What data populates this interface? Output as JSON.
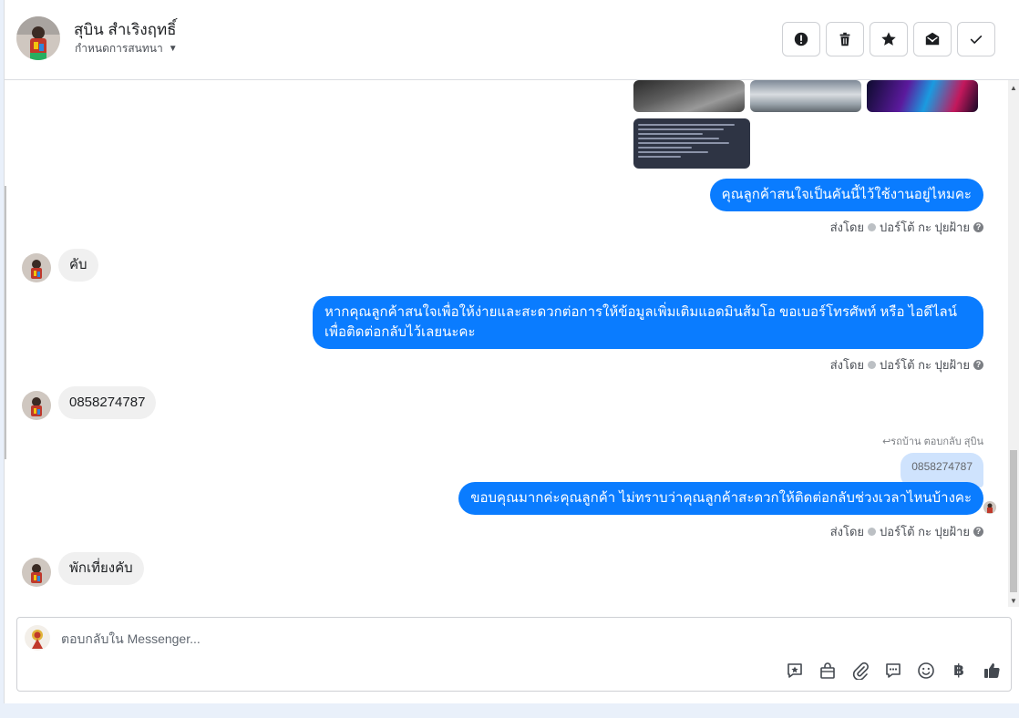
{
  "header": {
    "contact_name": "สุบิน สำเริงฤทธิ์",
    "assign_label": "กำหนดการสนทนา",
    "actions": [
      {
        "icon": "alert-icon",
        "name": "mark-spam-button"
      },
      {
        "icon": "trash-icon",
        "name": "delete-button"
      },
      {
        "icon": "star-icon",
        "name": "star-button"
      },
      {
        "icon": "mark-unread-icon",
        "name": "mark-unread-button"
      },
      {
        "icon": "check-icon",
        "name": "mark-done-button"
      }
    ]
  },
  "thread": {
    "messages": [
      {
        "dir": "out",
        "text": "คุณลูกค้าสนใจเป็นคันนี้ไว้ใช้งานอยู่ไหมคะ"
      },
      {
        "dir": "in",
        "text": "คับ"
      },
      {
        "dir": "out",
        "text": "หากคุณลูกค้าสนใจเพื่อให้ง่ายและสะดวกต่อการให้ข้อมูลเพิ่มเติมแอดมินส้มโอ ขอเบอร์โทรศัพท์ หรือ ไอดีไลน์\nเพื่อติดต่อกลับไว้เลยนะคะ"
      },
      {
        "dir": "in",
        "text": "0858274787"
      },
      {
        "dir": "out",
        "text": "ขอบคุณมากค่ะคุณลูกค้า ไม่ทราบว่าคุณลูกค้าสะดวกให้ติดต่อกลับช่วงเวลาไหนบ้างคะ"
      },
      {
        "dir": "in",
        "text": "พักเที่ยงคับ"
      }
    ],
    "sent_by_label": "ส่งโดย",
    "sent_by_name": "ปอร์โต้ กะ ปุยฝ้าย",
    "help_glyph": "?",
    "reply_note": "รถบ้าน ตอบกลับ สุบิน",
    "reply_quote": "0858274787"
  },
  "composer": {
    "placeholder": "ตอบกลับใน Messenger...",
    "value": "",
    "baht_symbol": "฿"
  },
  "colors": {
    "outgoing_bubble": "#0a7cff",
    "incoming_bubble": "#f0f0f0",
    "reply_bubble": "#cfe3fd"
  }
}
